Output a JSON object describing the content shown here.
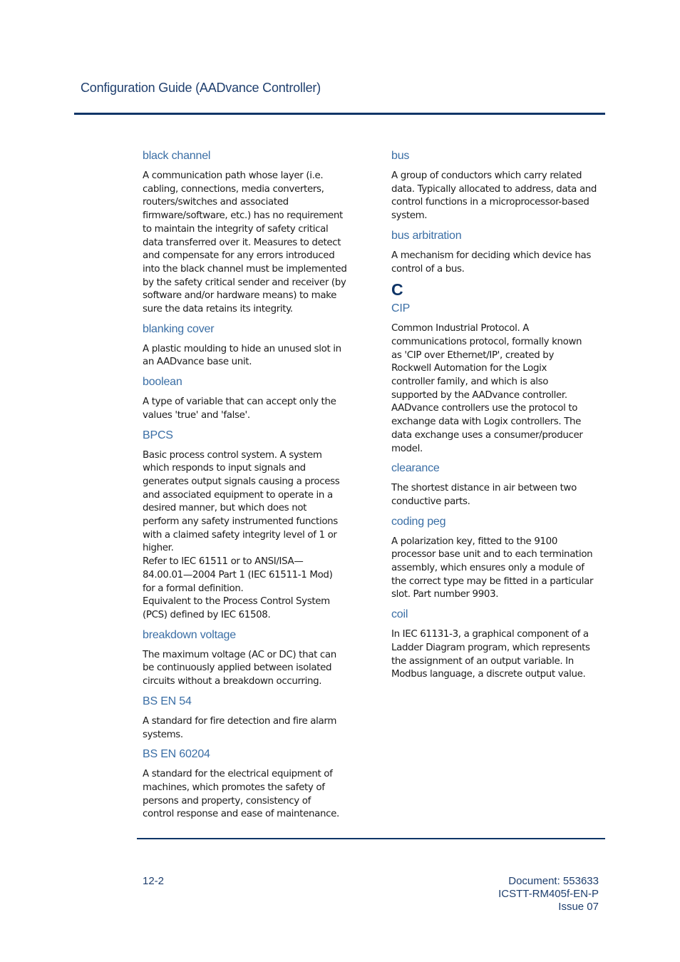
{
  "header": {
    "title": "Configuration Guide (AADvance Controller)"
  },
  "left_column": [
    {
      "term": "black channel",
      "definition": "A communication path whose layer (i.e.\ncabling, connections, media converters,\nrouters/switches and associated\nfirmware/software, etc.) has no requirement\nto maintain the integrity of safety critical\ndata transferred over it. Measures to detect\nand compensate for any errors introduced\ninto the black channel must be implemented\nby the safety critical sender and receiver (by\nsoftware and/or hardware means) to make\nsure the data retains its integrity."
    },
    {
      "term": "blanking cover",
      "definition": "A plastic moulding to hide an unused slot in\nan AADvance base unit."
    },
    {
      "term": "boolean",
      "definition": "A type of variable that can accept only the\nvalues 'true' and 'false'."
    },
    {
      "term": "BPCS",
      "definition": "Basic process control system. A system\nwhich responds to input signals and\ngenerates output signals causing a process\nand associated equipment to operate in a\ndesired manner, but which does not\nperform any safety instrumented functions\nwith a claimed safety integrity level of 1 or\nhigher.\nRefer to IEC 61511 or to ANSI/ISA—\n84.00.01—2004 Part 1 (IEC 61511-1 Mod)\nfor a formal definition.\nEquivalent to the Process Control System\n(PCS) defined by IEC 61508."
    },
    {
      "term": "breakdown voltage",
      "definition": "The maximum voltage (AC or DC) that can\nbe continuously applied between isolated\ncircuits without a breakdown occurring."
    },
    {
      "term": "BS EN 54",
      "definition": "A standard for fire detection and fire alarm\nsystems."
    },
    {
      "term": "BS EN 60204",
      "definition": "A standard for the electrical equipment of\nmachines, which promotes the safety of\npersons and property, consistency of\ncontrol response and ease of maintenance."
    }
  ],
  "right_column": {
    "before_letter": [
      {
        "term": "bus",
        "definition": "A group of conductors which carry related\ndata. Typically allocated to address, data and\ncontrol functions in a microprocessor-based\nsystem."
      },
      {
        "term": "bus arbitration",
        "definition": "A mechanism for deciding which device has\ncontrol of a bus."
      }
    ],
    "section_letter": "C",
    "after_letter": [
      {
        "term": "CIP",
        "definition": "Common Industrial Protocol. A\ncommunications protocol, formally known\nas 'CIP over Ethernet/IP', created by\nRockwell Automation for the Logix\ncontroller family, and which is also\nsupported by the AADvance controller.\nAADvance controllers use the protocol to\nexchange data with Logix controllers. The\ndata exchange uses a consumer/producer\nmodel."
      },
      {
        "term": "clearance",
        "definition": "The shortest distance in air between two\nconductive parts."
      },
      {
        "term": "coding peg",
        "definition": "A polarization key, fitted to the 9100\nprocessor base unit and to each termination\nassembly, which ensures only a module of\nthe correct type may be fitted in a particular\nslot. Part number 9903."
      },
      {
        "term": "coil",
        "definition": "In IEC 61131-3, a graphical component of a\nLadder Diagram program, which represents\nthe assignment of an output variable. In\nModbus language, a discrete output value."
      }
    ]
  },
  "footer": {
    "page_number": "12-2",
    "document": "Document: 553633",
    "publication": "ICSTT-RM405f-EN-P",
    "issue": "Issue 07"
  },
  "colors": {
    "header_text": "#1f3f6e",
    "rule": "#0f3567",
    "term": "#3a6ea5",
    "body_text": "#1a1a1a"
  }
}
